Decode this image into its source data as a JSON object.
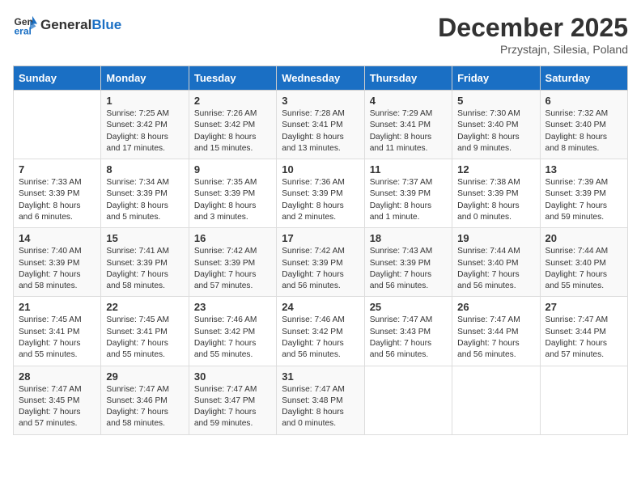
{
  "logo": {
    "general": "General",
    "blue": "Blue"
  },
  "header": {
    "month": "December 2025",
    "location": "Przystajn, Silesia, Poland"
  },
  "weekdays": [
    "Sunday",
    "Monday",
    "Tuesday",
    "Wednesday",
    "Thursday",
    "Friday",
    "Saturday"
  ],
  "weeks": [
    [
      {
        "day": "",
        "sunrise": "",
        "sunset": "",
        "daylight": ""
      },
      {
        "day": "1",
        "sunrise": "Sunrise: 7:25 AM",
        "sunset": "Sunset: 3:42 PM",
        "daylight": "Daylight: 8 hours and 17 minutes."
      },
      {
        "day": "2",
        "sunrise": "Sunrise: 7:26 AM",
        "sunset": "Sunset: 3:42 PM",
        "daylight": "Daylight: 8 hours and 15 minutes."
      },
      {
        "day": "3",
        "sunrise": "Sunrise: 7:28 AM",
        "sunset": "Sunset: 3:41 PM",
        "daylight": "Daylight: 8 hours and 13 minutes."
      },
      {
        "day": "4",
        "sunrise": "Sunrise: 7:29 AM",
        "sunset": "Sunset: 3:41 PM",
        "daylight": "Daylight: 8 hours and 11 minutes."
      },
      {
        "day": "5",
        "sunrise": "Sunrise: 7:30 AM",
        "sunset": "Sunset: 3:40 PM",
        "daylight": "Daylight: 8 hours and 9 minutes."
      },
      {
        "day": "6",
        "sunrise": "Sunrise: 7:32 AM",
        "sunset": "Sunset: 3:40 PM",
        "daylight": "Daylight: 8 hours and 8 minutes."
      }
    ],
    [
      {
        "day": "7",
        "sunrise": "Sunrise: 7:33 AM",
        "sunset": "Sunset: 3:39 PM",
        "daylight": "Daylight: 8 hours and 6 minutes."
      },
      {
        "day": "8",
        "sunrise": "Sunrise: 7:34 AM",
        "sunset": "Sunset: 3:39 PM",
        "daylight": "Daylight: 8 hours and 5 minutes."
      },
      {
        "day": "9",
        "sunrise": "Sunrise: 7:35 AM",
        "sunset": "Sunset: 3:39 PM",
        "daylight": "Daylight: 8 hours and 3 minutes."
      },
      {
        "day": "10",
        "sunrise": "Sunrise: 7:36 AM",
        "sunset": "Sunset: 3:39 PM",
        "daylight": "Daylight: 8 hours and 2 minutes."
      },
      {
        "day": "11",
        "sunrise": "Sunrise: 7:37 AM",
        "sunset": "Sunset: 3:39 PM",
        "daylight": "Daylight: 8 hours and 1 minute."
      },
      {
        "day": "12",
        "sunrise": "Sunrise: 7:38 AM",
        "sunset": "Sunset: 3:39 PM",
        "daylight": "Daylight: 8 hours and 0 minutes."
      },
      {
        "day": "13",
        "sunrise": "Sunrise: 7:39 AM",
        "sunset": "Sunset: 3:39 PM",
        "daylight": "Daylight: 7 hours and 59 minutes."
      }
    ],
    [
      {
        "day": "14",
        "sunrise": "Sunrise: 7:40 AM",
        "sunset": "Sunset: 3:39 PM",
        "daylight": "Daylight: 7 hours and 58 minutes."
      },
      {
        "day": "15",
        "sunrise": "Sunrise: 7:41 AM",
        "sunset": "Sunset: 3:39 PM",
        "daylight": "Daylight: 7 hours and 58 minutes."
      },
      {
        "day": "16",
        "sunrise": "Sunrise: 7:42 AM",
        "sunset": "Sunset: 3:39 PM",
        "daylight": "Daylight: 7 hours and 57 minutes."
      },
      {
        "day": "17",
        "sunrise": "Sunrise: 7:42 AM",
        "sunset": "Sunset: 3:39 PM",
        "daylight": "Daylight: 7 hours and 56 minutes."
      },
      {
        "day": "18",
        "sunrise": "Sunrise: 7:43 AM",
        "sunset": "Sunset: 3:39 PM",
        "daylight": "Daylight: 7 hours and 56 minutes."
      },
      {
        "day": "19",
        "sunrise": "Sunrise: 7:44 AM",
        "sunset": "Sunset: 3:40 PM",
        "daylight": "Daylight: 7 hours and 56 minutes."
      },
      {
        "day": "20",
        "sunrise": "Sunrise: 7:44 AM",
        "sunset": "Sunset: 3:40 PM",
        "daylight": "Daylight: 7 hours and 55 minutes."
      }
    ],
    [
      {
        "day": "21",
        "sunrise": "Sunrise: 7:45 AM",
        "sunset": "Sunset: 3:41 PM",
        "daylight": "Daylight: 7 hours and 55 minutes."
      },
      {
        "day": "22",
        "sunrise": "Sunrise: 7:45 AM",
        "sunset": "Sunset: 3:41 PM",
        "daylight": "Daylight: 7 hours and 55 minutes."
      },
      {
        "day": "23",
        "sunrise": "Sunrise: 7:46 AM",
        "sunset": "Sunset: 3:42 PM",
        "daylight": "Daylight: 7 hours and 55 minutes."
      },
      {
        "day": "24",
        "sunrise": "Sunrise: 7:46 AM",
        "sunset": "Sunset: 3:42 PM",
        "daylight": "Daylight: 7 hours and 56 minutes."
      },
      {
        "day": "25",
        "sunrise": "Sunrise: 7:47 AM",
        "sunset": "Sunset: 3:43 PM",
        "daylight": "Daylight: 7 hours and 56 minutes."
      },
      {
        "day": "26",
        "sunrise": "Sunrise: 7:47 AM",
        "sunset": "Sunset: 3:44 PM",
        "daylight": "Daylight: 7 hours and 56 minutes."
      },
      {
        "day": "27",
        "sunrise": "Sunrise: 7:47 AM",
        "sunset": "Sunset: 3:44 PM",
        "daylight": "Daylight: 7 hours and 57 minutes."
      }
    ],
    [
      {
        "day": "28",
        "sunrise": "Sunrise: 7:47 AM",
        "sunset": "Sunset: 3:45 PM",
        "daylight": "Daylight: 7 hours and 57 minutes."
      },
      {
        "day": "29",
        "sunrise": "Sunrise: 7:47 AM",
        "sunset": "Sunset: 3:46 PM",
        "daylight": "Daylight: 7 hours and 58 minutes."
      },
      {
        "day": "30",
        "sunrise": "Sunrise: 7:47 AM",
        "sunset": "Sunset: 3:47 PM",
        "daylight": "Daylight: 7 hours and 59 minutes."
      },
      {
        "day": "31",
        "sunrise": "Sunrise: 7:47 AM",
        "sunset": "Sunset: 3:48 PM",
        "daylight": "Daylight: 8 hours and 0 minutes."
      },
      {
        "day": "",
        "sunrise": "",
        "sunset": "",
        "daylight": ""
      },
      {
        "day": "",
        "sunrise": "",
        "sunset": "",
        "daylight": ""
      },
      {
        "day": "",
        "sunrise": "",
        "sunset": "",
        "daylight": ""
      }
    ]
  ]
}
